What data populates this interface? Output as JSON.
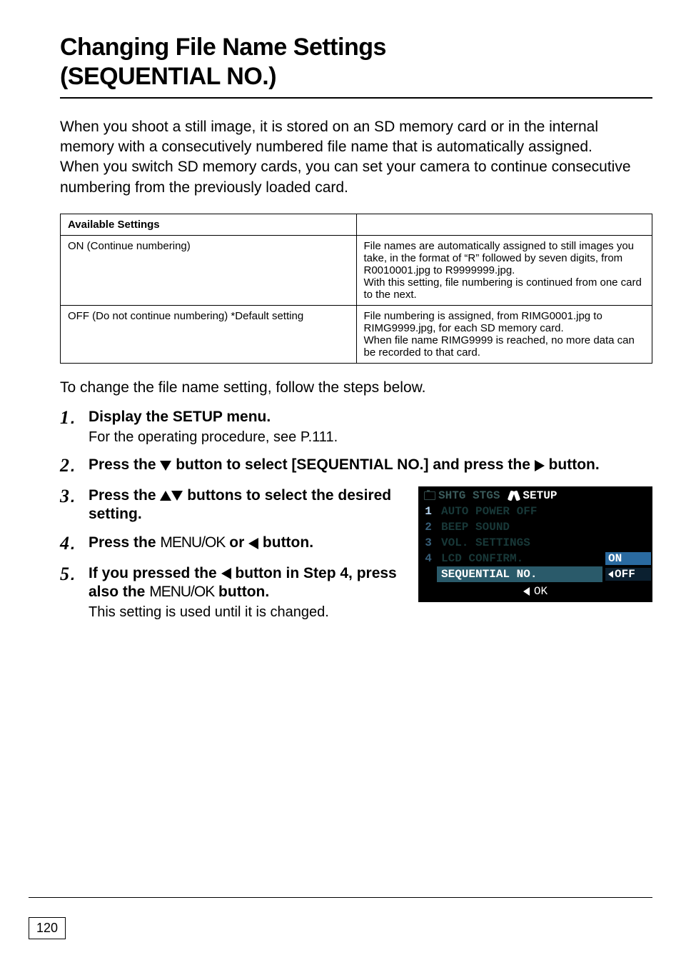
{
  "title_line1": "Changing File Name Settings",
  "title_line2": "(SEQUENTIAL NO.)",
  "intro": "When you shoot a still image, it is stored on an SD memory card or in the internal memory with a consecutively numbered file name that is automatically assigned.\nWhen you switch SD memory cards, you can set your camera to continue consecutive numbering from the previously loaded card.",
  "table": {
    "header": "Available Settings",
    "rows": [
      {
        "setting": "ON (Continue numbering)",
        "desc": "File names are automatically assigned to still images you take, in the format of “R” followed by seven digits, from R0010001.jpg to R9999999.jpg.\nWith this setting, file numbering is continued from one card to the next."
      },
      {
        "setting": "OFF (Do not continue numbering) *Default setting",
        "desc": "File numbering is assigned, from RIMG0001.jpg to RIMG9999.jpg, for each SD memory card.\nWhen file name RIMG9999 is reached, no more data can be recorded to that card."
      }
    ]
  },
  "subintro": "To change the file name setting, follow the steps below.",
  "steps": [
    {
      "num": "1",
      "head": "Display the SETUP menu.",
      "note": "For the operating procedure, see P.111."
    },
    {
      "num": "2",
      "head_parts": [
        "Press the ",
        " button to select [SEQUENTIAL NO.] and press the ",
        " button."
      ]
    },
    {
      "num": "3",
      "head_parts": [
        "Press the ",
        " buttons to select the desired setting."
      ]
    },
    {
      "num": "4",
      "head_parts": [
        "Press the ",
        " or ",
        " button."
      ],
      "menuok": "MENU/OK"
    },
    {
      "num": "5",
      "head_parts": [
        "If you pressed the ",
        " button in Step 4, press also the ",
        " button."
      ],
      "menuok": "MENU/OK",
      "note": "This setting is used until it is changed."
    }
  ],
  "lcd": {
    "tabs": {
      "left": "SHTG STGS",
      "right": "SETUP"
    },
    "rows": [
      {
        "n": "1",
        "label": "AUTO POWER OFF"
      },
      {
        "n": "2",
        "label": "BEEP SOUND"
      },
      {
        "n": "3",
        "label": "VOL. SETTINGS"
      },
      {
        "n": "4",
        "label": "LCD CONFIRM.",
        "val_on": "ON"
      },
      {
        "n": "",
        "label": "SEQUENTIAL NO.",
        "hl": true,
        "val_off": "OFF"
      }
    ],
    "ok": "OK"
  },
  "page_number": "120"
}
